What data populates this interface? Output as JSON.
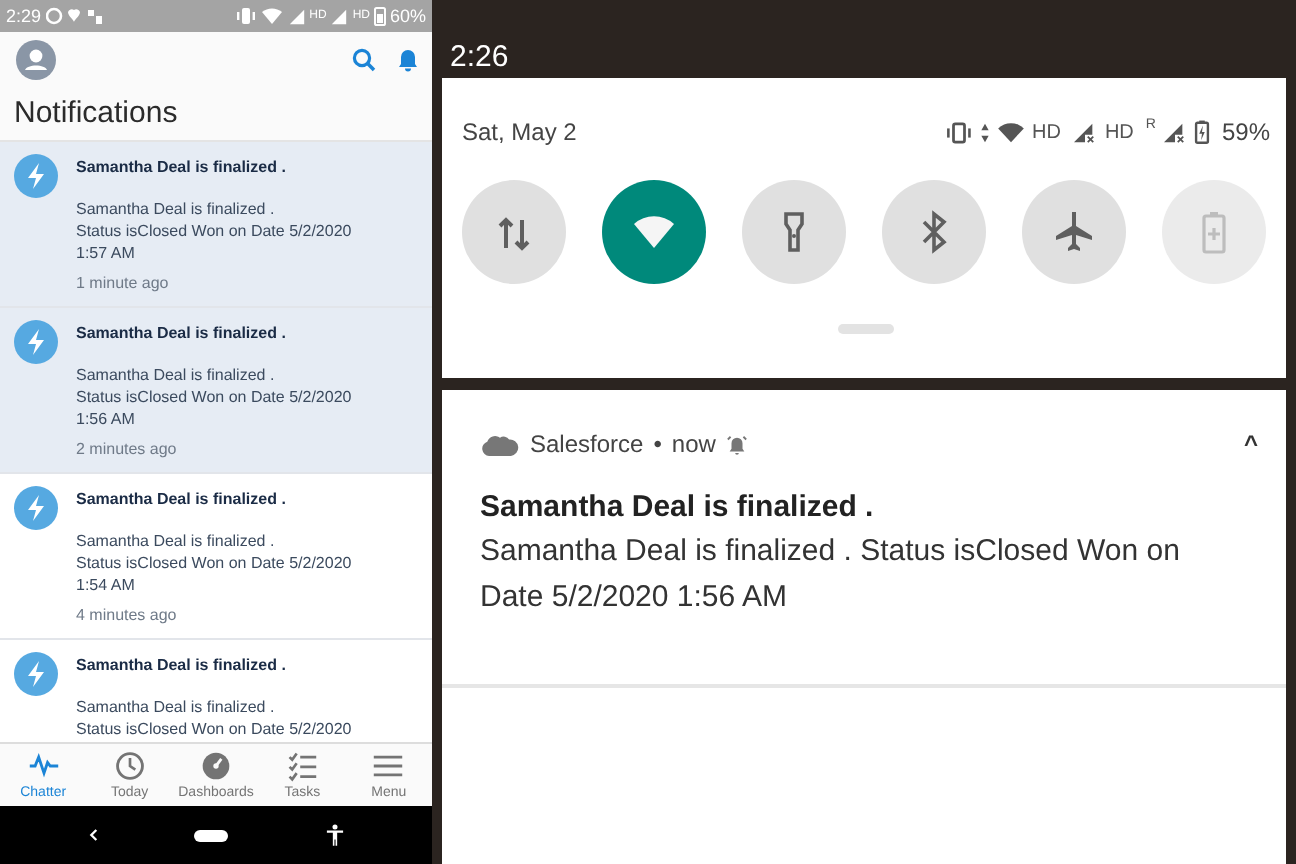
{
  "phone_app": {
    "status_bar": {
      "time": "2:29",
      "network_labels": [
        "HD",
        "HD"
      ],
      "battery": "60%"
    },
    "title": "Notifications",
    "notifications": [
      {
        "title": "Samantha Deal is finalized .",
        "body": [
          "Samantha Deal is finalized .",
          "Status isClosed Won on Date 5/2/2020",
          "1:57 AM"
        ],
        "time": "1 minute ago",
        "unread": true
      },
      {
        "title": "Samantha Deal is finalized .",
        "body": [
          "Samantha Deal is finalized .",
          "Status isClosed Won on Date 5/2/2020",
          "1:56 AM"
        ],
        "time": "2 minutes ago",
        "unread": true
      },
      {
        "title": "Samantha Deal is finalized .",
        "body": [
          "Samantha Deal is finalized .",
          "Status isClosed Won on Date 5/2/2020",
          "1:54 AM"
        ],
        "time": "4 minutes ago",
        "unread": false
      },
      {
        "title": "Samantha Deal is finalized .",
        "body": [
          "Samantha Deal is finalized .",
          "Status isClosed Won on Date 5/2/2020"
        ],
        "unread": false
      }
    ],
    "tabs": [
      {
        "kind": "chatter",
        "label": "Chatter",
        "selected": true
      },
      {
        "kind": "today",
        "label": "Today",
        "selected": false
      },
      {
        "kind": "dashboards",
        "label": "Dashboards",
        "selected": false
      },
      {
        "kind": "tasks",
        "label": "Tasks",
        "selected": false
      },
      {
        "kind": "menu",
        "label": "Menu",
        "selected": false
      }
    ]
  },
  "shade": {
    "time": "2:26",
    "date": "Sat, May 2",
    "network_labels": [
      "HD",
      "HD"
    ],
    "roaming": "R",
    "battery": "59%",
    "tiles": [
      {
        "kind": "data",
        "on": false,
        "disabled": false
      },
      {
        "kind": "wifi",
        "on": true,
        "disabled": false
      },
      {
        "kind": "flashlight",
        "on": false,
        "disabled": false
      },
      {
        "kind": "bluetooth",
        "on": false,
        "disabled": false
      },
      {
        "kind": "airplane",
        "on": false,
        "disabled": false
      },
      {
        "kind": "battery",
        "on": false,
        "disabled": true
      }
    ],
    "notification": {
      "app": "Salesforce",
      "separator": "•",
      "when": "now",
      "expand": "^",
      "title": "Samantha Deal is finalized .",
      "text": "Samantha Deal is finalized . Status isClosed Won on Date 5/2/2020 1:56 AM"
    }
  }
}
